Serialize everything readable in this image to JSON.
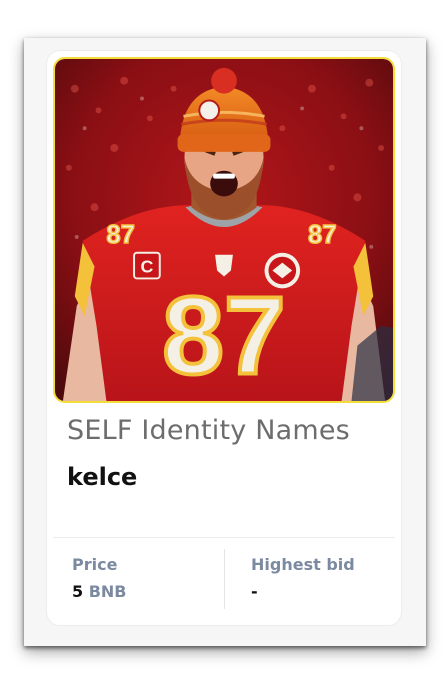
{
  "card": {
    "collection_name": "SELF Identity Names",
    "item_name": "kelce",
    "price": {
      "label": "Price",
      "amount": "5",
      "currency": "BNB"
    },
    "highest_bid": {
      "label": "Highest bid",
      "value": "-"
    },
    "image": {
      "jersey_number": "87",
      "patch_letter": "C"
    }
  },
  "colors": {
    "label": "#7c8aa1",
    "title": "#6d6d6d",
    "image_border": "#f2de3b",
    "jersey": "#d8201f",
    "beanie": "#f07a1c"
  }
}
